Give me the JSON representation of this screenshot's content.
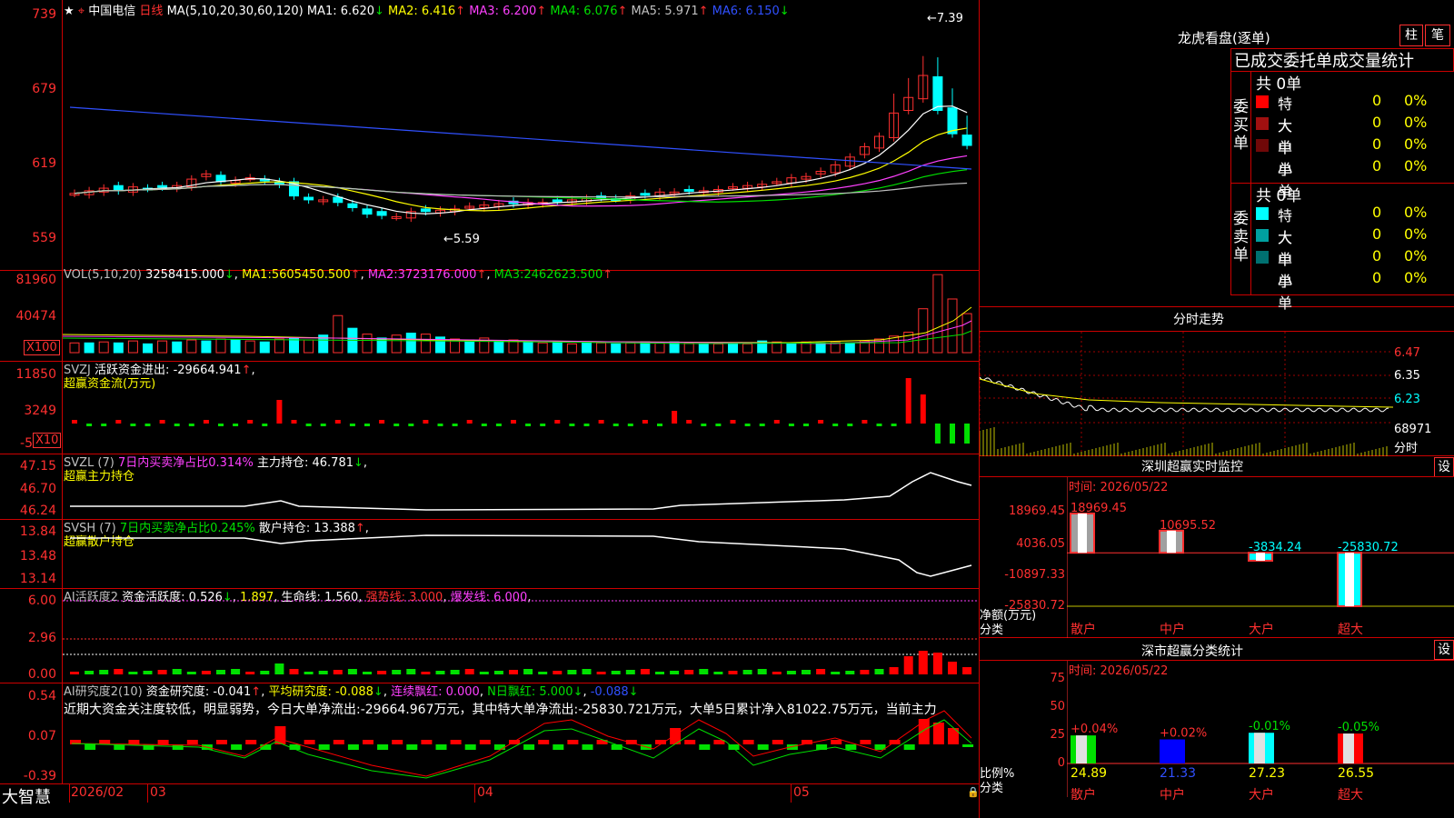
{
  "header": {
    "star": "★",
    "stock": "中国电信",
    "period": "日线",
    "ma_title": "MA(5,10,20,30,60,120)",
    "ma": [
      {
        "name": "MA1:",
        "value": "6.620",
        "arrow": "↓",
        "color": "#ffffff"
      },
      {
        "name": "MA2:",
        "value": "6.416",
        "arrow": "↑",
        "color": "#ffff00"
      },
      {
        "name": "MA3:",
        "value": "6.200",
        "arrow": "↑",
        "color": "#ff40ff"
      },
      {
        "name": "MA4:",
        "value": "6.076",
        "arrow": "↑",
        "color": "#00e000"
      },
      {
        "name": "MA5:",
        "value": "5.971",
        "arrow": "↑",
        "color": "#c0c0c0"
      },
      {
        "name": "MA6:",
        "value": "6.150",
        "arrow": "↓",
        "color": "#3050ff"
      }
    ],
    "high_label": "7.39",
    "low_label": "5.59"
  },
  "price_axis": [
    "739",
    "679",
    "619",
    "559"
  ],
  "vol_panel": {
    "title": "VOL(5,10,20)",
    "value": "3258415.000",
    "arrow1": "↓",
    "ma1": "MA1:",
    "ma1v": "5605450.500",
    "ma1a": "↑",
    "ma2": "MA2:",
    "ma2v": "3723176.000",
    "ma2a": "↑",
    "ma3": "MA3:",
    "ma3v": "2462623.500",
    "ma3a": "↑",
    "axis": [
      "81960",
      "40474"
    ],
    "unit": "X100"
  },
  "svzj_panel": {
    "title": "SVZJ",
    "label": "活跃资金进出:",
    "value": "-29664.941",
    "arrow": "↑",
    "sub": "超赢资金流(万元)",
    "axis": [
      "11850",
      "3249",
      "-5"
    ],
    "unit": "X10"
  },
  "svzl_panel": {
    "title": "SVZL (7)",
    "label": "7日内买卖净占比0.314%",
    "l2": "主力持仓:",
    "v2": "46.781",
    "a2": "↓",
    "sub": "超赢主力持仓",
    "axis": [
      "47.15",
      "46.70",
      "46.24"
    ]
  },
  "svsh_panel": {
    "title": "SVSH (7)",
    "label": "7日内买卖净占比0.245%",
    "l2": "散户持仓:",
    "v2": "13.388",
    "a2": "↑",
    "sub": "超赢散户持仓",
    "axis": [
      "13.84",
      "13.48",
      "13.14"
    ]
  },
  "ai1_panel": {
    "title": "AI活跃度2",
    "l1": "资金活跃度:",
    "v1": "0.526",
    "a1": "↓",
    "v1b": "1.897",
    "l2": "生命线:",
    "v2": "1.560",
    "l3": "强势线:",
    "v3": "3.000",
    "l4": "爆发线:",
    "v4": "6.000",
    "axis": [
      "6.00",
      "2.96",
      "0.00"
    ]
  },
  "ai2_panel": {
    "title": "AI研究度2(10)",
    "l1": "资金研究度:",
    "v1": "-0.041",
    "a1": "↑",
    "l2": "平均研究度:",
    "v2": "-0.088",
    "a2": "↓",
    "l3": "连续飘红:",
    "v3": "0.000",
    "l4": "N日飘红:",
    "v4": "5.000",
    "a4": "↓",
    "v5": "-0.088",
    "a5": "↓",
    "note": "近期大资金关注度较低，明显弱势，今日大单净流出:-29664.967万元，其中特大单净流出:-25830.721万元，大单5日累计净入81022.75万元，当前主力",
    "axis": [
      "0.54",
      "0.07",
      "-0.39"
    ]
  },
  "bottom": {
    "brand": "大智慧",
    "dates": [
      "2026/02",
      "03",
      "04",
      "05"
    ]
  },
  "lhb": {
    "title": "龙虎看盘(逐单)",
    "btn1": "柱",
    "btn2": "笔",
    "tabs": "已成交委托单成交量统计",
    "buy_label": "委买单",
    "sell_label": "委卖单",
    "buy": {
      "total": "共 0单",
      "rows": [
        {
          "name": "特大",
          "n": "0",
          "p": "0%",
          "color": "#ff0000"
        },
        {
          "name": "大单",
          "n": "0",
          "p": "0%",
          "color": "#a01010"
        },
        {
          "name": "中单",
          "n": "0",
          "p": "0%",
          "color": "#700808"
        },
        {
          "name": "小单",
          "n": "0",
          "p": "0%",
          "color": "#000000"
        }
      ]
    },
    "sell": {
      "total": "共 0单",
      "rows": [
        {
          "name": "特大",
          "n": "0",
          "p": "0%",
          "color": "#00ffff"
        },
        {
          "name": "大单",
          "n": "0",
          "p": "0%",
          "color": "#00a0a0"
        },
        {
          "name": "中单",
          "n": "0",
          "p": "0%",
          "color": "#007070"
        },
        {
          "name": "小单",
          "n": "0",
          "p": "0%",
          "color": "#000000"
        }
      ]
    }
  },
  "fenshi": {
    "title": "分时走势",
    "axis": [
      "6.47",
      "6.35",
      "6.23",
      "68971",
      "分时"
    ]
  },
  "monitor": {
    "title": "深圳超赢实时监控",
    "btn": "设",
    "time": "时间: 2026/05/22",
    "axis": [
      "18969.45",
      "4036.05",
      "-10897.33",
      "-25830.72"
    ],
    "ylabel": "净额(万元)",
    "xlabel": "分类"
  },
  "classify": {
    "title": "深市超赢分类统计",
    "btn": "设",
    "time": "时间: 2026/05/22",
    "axis": [
      "75",
      "50",
      "25",
      "0"
    ],
    "ylabel": "比例%",
    "xlabel": "分类"
  },
  "chart_data": [
    {
      "type": "bar",
      "title": "深圳超赢实时监控",
      "ylabel": "净额(万元)",
      "xlabel": "分类",
      "categories": [
        "散户",
        "中户",
        "大户",
        "超大"
      ],
      "values": [
        18969.45,
        10695.52,
        -3834.24,
        -25830.72
      ],
      "ylim": [
        -25830.72,
        18969.45
      ]
    },
    {
      "type": "bar",
      "title": "深市超赢分类统计",
      "ylabel": "比例%",
      "xlabel": "分类",
      "categories": [
        "散户",
        "中户",
        "大户",
        "超大"
      ],
      "values": [
        24.89,
        21.33,
        27.23,
        26.55
      ],
      "changes": [
        "+0.04%",
        "+0.02%",
        "-0.01%",
        "-0.05%"
      ],
      "ylim": [
        0,
        75
      ]
    }
  ]
}
